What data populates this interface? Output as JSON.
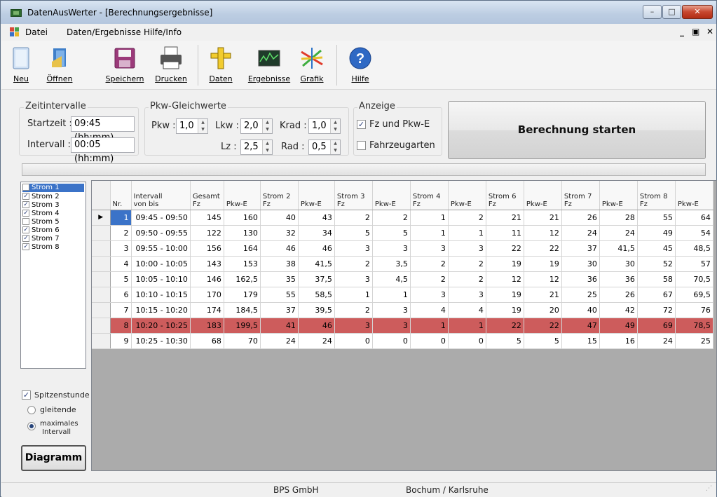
{
  "window": {
    "title": "DatenAusWerter - [Berechnungsergebnisse]"
  },
  "menu": {
    "items": [
      "Datei",
      "Daten/Ergebnisse",
      "Hilfe/Info"
    ],
    "mdi_controls": "_ &#x2750; ✕"
  },
  "toolbar": {
    "neu": "Neu",
    "oeffnen": "Öffnen",
    "speichern": "Speichern",
    "drucken": "Drucken",
    "daten": "Daten",
    "ergebnisse": "Ergebnisse",
    "grafik": "Grafik",
    "hilfe": "Hilfe"
  },
  "zeit": {
    "group": "Zeitintervalle",
    "start_label": "Startzeit :",
    "start_value": "09:45 (hh:mm)",
    "interval_label": "Intervall :",
    "interval_value": "00:05 (hh:mm)"
  },
  "pkw": {
    "group": "Pkw-Gleichwerte",
    "pkw_label": "Pkw :",
    "pkw_value": "1,0",
    "lkw_label": "Lkw :",
    "lkw_value": "2,0",
    "krad_label": "Krad :",
    "krad_value": "1,0",
    "lz_label": "Lz :",
    "lz_value": "2,5",
    "rad_label": "Rad :",
    "rad_value": "0,5"
  },
  "anzeige": {
    "group": "Anzeige",
    "fz_pkw": "Fz und Pkw-E",
    "fz_pkw_checked": true,
    "fahrzeugarten": "Fahrzeugarten",
    "fahrzeugarten_checked": false
  },
  "start_button": "Berechnung starten",
  "streams": [
    {
      "label": "Strom 1",
      "checked": false,
      "selected": true
    },
    {
      "label": "Strom 2",
      "checked": true
    },
    {
      "label": "Strom 3",
      "checked": true
    },
    {
      "label": "Strom 4",
      "checked": true
    },
    {
      "label": "Strom 5",
      "checked": false
    },
    {
      "label": "Strom 6",
      "checked": true
    },
    {
      "label": "Strom 7",
      "checked": true
    },
    {
      "label": "Strom 8",
      "checked": true
    }
  ],
  "spitzen": {
    "label": "Spitzenstunde",
    "checked": true,
    "gleitende": "gleitende",
    "maximales_1": "maximales",
    "maximales_2": "Intervall",
    "selected": "maximales"
  },
  "diagramm_button": "Diagramm",
  "table": {
    "headers": [
      [
        "Nr."
      ],
      [
        "Intervall",
        "von   bis"
      ],
      [
        "Gesamt",
        "Fz"
      ],
      [
        "Pkw-E"
      ],
      [
        "Strom 2",
        "Fz"
      ],
      [
        "Pkw-E"
      ],
      [
        "Strom 3",
        "Fz"
      ],
      [
        "Pkw-E"
      ],
      [
        "Strom 4",
        "Fz"
      ],
      [
        "Pkw-E"
      ],
      [
        "Strom 6",
        "Fz"
      ],
      [
        "Pkw-E"
      ],
      [
        "Strom 7",
        "Fz"
      ],
      [
        "Pkw-E"
      ],
      [
        "Strom 8",
        "Fz"
      ],
      [
        "Pkw-E"
      ]
    ],
    "rows": [
      [
        "1",
        "09:45 - 09:50",
        "145",
        "160",
        "40",
        "43",
        "2",
        "2",
        "1",
        "2",
        "21",
        "21",
        "26",
        "28",
        "55",
        "64"
      ],
      [
        "2",
        "09:50 - 09:55",
        "122",
        "130",
        "32",
        "34",
        "5",
        "5",
        "1",
        "1",
        "11",
        "12",
        "24",
        "24",
        "49",
        "54"
      ],
      [
        "3",
        "09:55 - 10:00",
        "156",
        "164",
        "46",
        "46",
        "3",
        "3",
        "3",
        "3",
        "22",
        "22",
        "37",
        "41,5",
        "45",
        "48,5"
      ],
      [
        "4",
        "10:00 - 10:05",
        "143",
        "153",
        "38",
        "41,5",
        "2",
        "3,5",
        "2",
        "2",
        "19",
        "19",
        "30",
        "30",
        "52",
        "57"
      ],
      [
        "5",
        "10:05 - 10:10",
        "146",
        "162,5",
        "35",
        "37,5",
        "3",
        "4,5",
        "2",
        "2",
        "12",
        "12",
        "36",
        "36",
        "58",
        "70,5"
      ],
      [
        "6",
        "10:10 - 10:15",
        "170",
        "179",
        "55",
        "58,5",
        "1",
        "1",
        "3",
        "3",
        "19",
        "21",
        "25",
        "26",
        "67",
        "69,5"
      ],
      [
        "7",
        "10:15 - 10:20",
        "174",
        "184,5",
        "37",
        "39,5",
        "2",
        "3",
        "4",
        "4",
        "19",
        "20",
        "40",
        "42",
        "72",
        "76"
      ],
      [
        "8",
        "10:20 - 10:25",
        "183",
        "199,5",
        "41",
        "46",
        "3",
        "3",
        "1",
        "1",
        "22",
        "22",
        "47",
        "49",
        "69",
        "78,5"
      ],
      [
        "9",
        "10:25 - 10:30",
        "68",
        "70",
        "24",
        "24",
        "0",
        "0",
        "0",
        "0",
        "5",
        "5",
        "15",
        "16",
        "24",
        "25"
      ]
    ],
    "highlight_row": 8,
    "highlight_color": "#cd5c5c"
  },
  "status": {
    "company": "BPS GmbH",
    "location": "Bochum / Karlsruhe"
  }
}
